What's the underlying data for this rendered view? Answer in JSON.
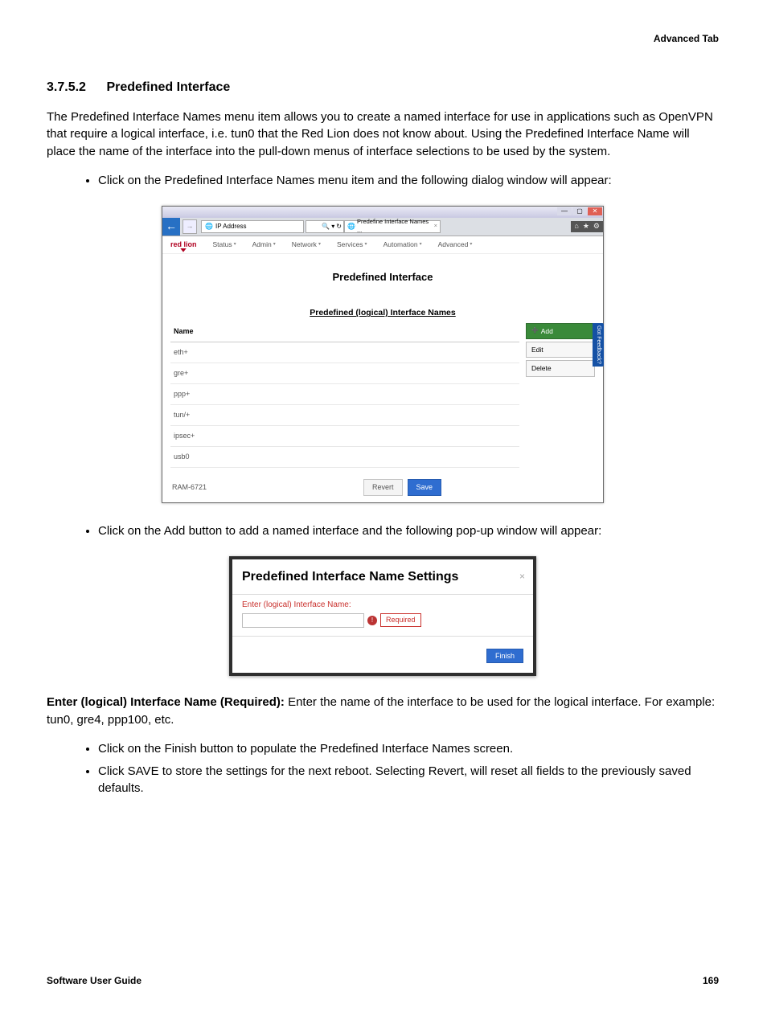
{
  "header_right": "Advanced Tab",
  "section": {
    "number": "3.7.5.2",
    "title": "Predefined Interface"
  },
  "intro": "The Predefined Interface Names menu item allows you to create a named interface for use in applications such as OpenVPN that require a logical interface, i.e. tun0 that the Red Lion does not know about. Using the Predefined Interface Name will place the name of the interface into the pull-down menus of interface selections to be used by the system.",
  "bullet1": "Click on the Predefined Interface Names menu item and the following dialog window will appear:",
  "bullet2": "Click on the Add button to add a named interface and the following pop-up window will appear:",
  "screenshot1": {
    "address_bar": "IP Address",
    "tab_label": "Predefine Interface Names ...",
    "search_hint": "⌕ • ☇ Ø",
    "brand": "red lion",
    "menus": [
      "Status",
      "Admin",
      "Network",
      "Services",
      "Automation",
      "Advanced"
    ],
    "page_title": "Predefined Interface",
    "subtitle": "Predefined (logical) Interface Names",
    "col_name": "Name",
    "rows": [
      "eth+",
      "gre+",
      "ppp+",
      "tun/+",
      "ipsec+",
      "usb0"
    ],
    "side": {
      "add": "Add",
      "edit": "Edit",
      "delete": "Delete"
    },
    "feedback": "Got Feedback?",
    "device": "RAM-6721",
    "revert": "Revert",
    "save": "Save"
  },
  "dialog": {
    "title": "Predefined Interface Name Settings",
    "close": "×",
    "label": "Enter (logical) Interface Name:",
    "required": "Required",
    "warn": "!",
    "finish": "Finish"
  },
  "field_desc": {
    "bold": "Enter (logical) Interface Name (Required): ",
    "rest": "Enter the name of the interface to be used for the logical interface. For example: tun0, gre4, ppp100, etc."
  },
  "bullet3": "Click on the Finish button to populate the Predefined Interface Names screen.",
  "bullet4": "Click SAVE to store the settings for the next reboot. Selecting Revert, will reset all fields to the previously saved defaults.",
  "footer": {
    "left": "Software User Guide",
    "right": "169"
  }
}
